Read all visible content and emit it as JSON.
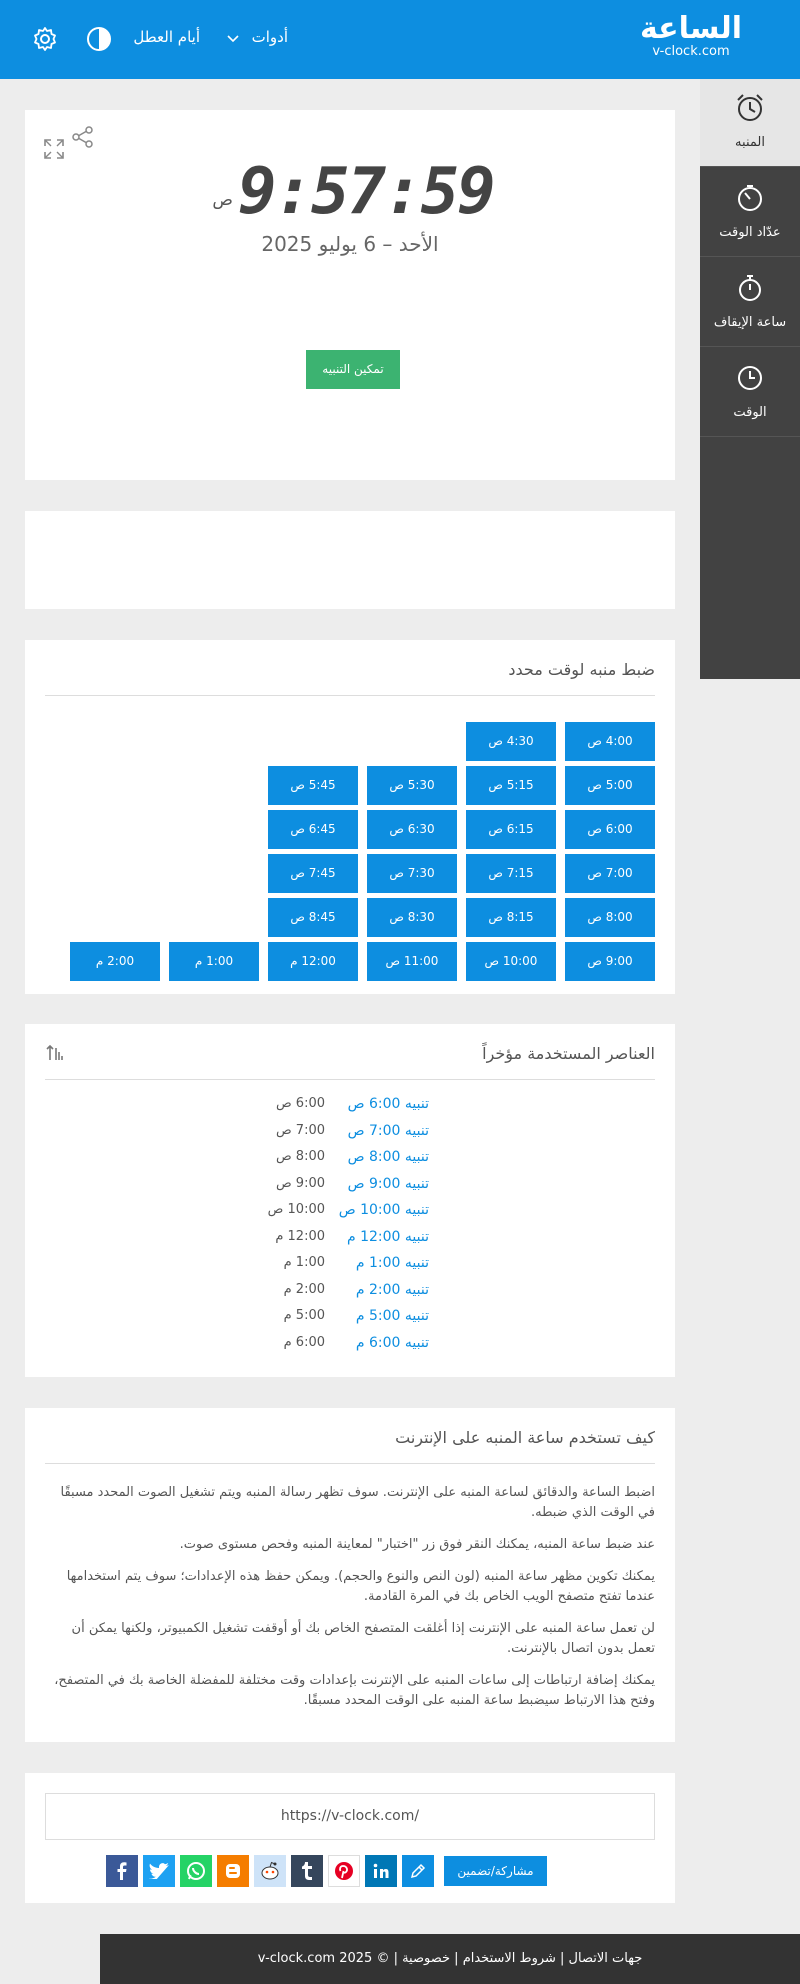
{
  "header": {
    "logo_main": "الساعة",
    "logo_sub": "v-clock.com",
    "nav_tools": "أدوات",
    "nav_holidays": "أيام العطل"
  },
  "sidebar": {
    "items": [
      {
        "label": "المنبه",
        "icon": "alarm-clock-icon",
        "active": true
      },
      {
        "label": "عدّاد الوقت",
        "icon": "timer-icon",
        "active": false
      },
      {
        "label": "ساعة الإيقاف",
        "icon": "stopwatch-icon",
        "active": false
      },
      {
        "label": "الوقت",
        "icon": "clock-icon",
        "active": false
      }
    ]
  },
  "clock": {
    "time": "9:57:59",
    "ampm": "ص",
    "date": "الأحد – 6 يوليو 2025",
    "enable_button": "تمكين التنبيه"
  },
  "presets": {
    "title": "ضبط منبه لوقت محدد",
    "columns": [
      [
        "4:00 ص",
        "5:00 ص",
        "6:00 ص",
        "7:00 ص",
        "8:00 ص",
        "9:00 ص"
      ],
      [
        "4:30 ص",
        "5:15 ص",
        "6:15 ص",
        "7:15 ص",
        "8:15 ص",
        "10:00 ص"
      ],
      [
        "5:30 ص",
        "6:30 ص",
        "7:30 ص",
        "8:30 ص",
        "11:00 ص"
      ],
      [
        "5:45 ص",
        "6:45 ص",
        "7:45 ص",
        "8:45 ص",
        "12:00 م"
      ],
      [
        "1:00 م"
      ],
      [
        "2:00 م"
      ]
    ]
  },
  "recent": {
    "title": "العناصر المستخدمة مؤخراً",
    "items": [
      {
        "link": "تنبيه 6:00 ص",
        "time": "6:00 ص"
      },
      {
        "link": "تنبيه 7:00 ص",
        "time": "7:00 ص"
      },
      {
        "link": "تنبيه 8:00 ص",
        "time": "8:00 ص"
      },
      {
        "link": "تنبيه 9:00 ص",
        "time": "9:00 ص"
      },
      {
        "link": "تنبيه 10:00 ص",
        "time": "10:00 ص"
      },
      {
        "link": "تنبيه 12:00 م",
        "time": "12:00 م"
      },
      {
        "link": "تنبيه 1:00 م",
        "time": "1:00 م"
      },
      {
        "link": "تنبيه 2:00 م",
        "time": "2:00 م"
      },
      {
        "link": "تنبيه 5:00 م",
        "time": "5:00 م"
      },
      {
        "link": "تنبيه 6:00 م",
        "time": "6:00 م"
      }
    ]
  },
  "howto": {
    "title": "كيف تستخدم ساعة المنبه على الإنترنت",
    "paragraphs": [
      "اضبط الساعة والدقائق لساعة المنبه على الإنترنت. سوف تظهر رسالة المنبه ويتم تشغيل الصوت المحدد مسبقًا في الوقت الذي ضبطه.",
      "عند ضبط ساعة المنبه، يمكنك النقر فوق زر \"اختبار\" لمعاينة المنبه وفحص مستوى صوت.",
      "يمكنك تكوين مظهر ساعة المنبه (لون النص والنوع والحجم). ويمكن حفظ هذه الإعدادات؛ سوف يتم استخدامها عندما تفتح متصفح الويب الخاص بك في المرة القادمة.",
      "لن تعمل ساعة المنبه على الإنترنت إذا أغلقت المتصفح الخاص بك أو أوقفت تشغيل الكمبيوتر، ولكنها يمكن أن تعمل بدون اتصال بالإنترنت.",
      "يمكنك إضافة ارتباطات إلى ساعات المنبه على الإنترنت بإعدادات وقت مختلفة للمفضلة الخاصة بك في المتصفح، وفتح هذا الارتباط سيضبط ساعة المنبه على الوقت المحدد مسبقًا."
    ]
  },
  "share": {
    "url": "https://v-clock.com/",
    "embed_label": "مشاركة/تضمين",
    "icons": [
      "facebook-icon",
      "twitter-icon",
      "whatsapp-icon",
      "blogger-icon",
      "reddit-icon",
      "tumblr-icon",
      "pinterest-icon",
      "linkedin-icon",
      "edit-icon"
    ],
    "colors": {
      "facebook": "#3b5998",
      "twitter": "#1da1f2",
      "whatsapp": "#25d366",
      "blogger": "#f57d00",
      "reddit": "#cee3f8",
      "tumblr": "#35465c",
      "pinterest": "#ffffff",
      "linkedin": "#0077b5",
      "edit": "#0d8ee0"
    }
  },
  "footer": {
    "text": "جهات الاتصال | شروط الاستخدام | خصوصية | © 2025 v-clock.com"
  },
  "colors": {
    "accent": "#0d8ee0",
    "enable": "#3cb371",
    "sidebar": "#424242"
  }
}
